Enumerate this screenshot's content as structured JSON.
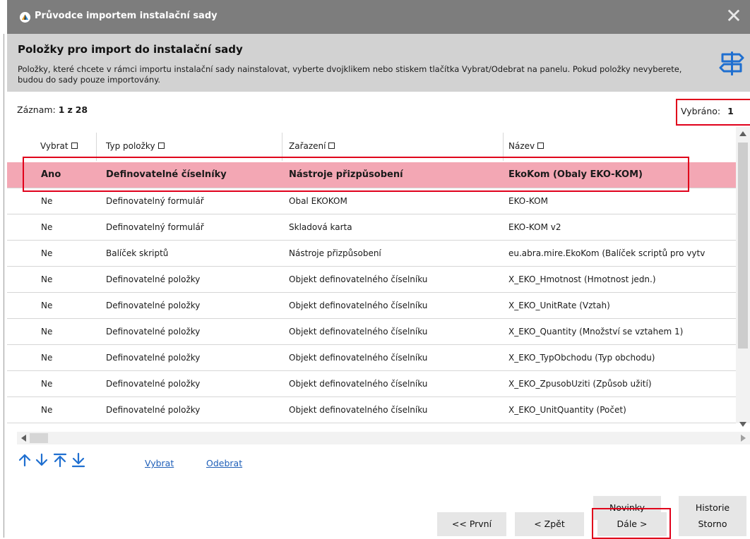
{
  "window": {
    "title": "Průvodce importem instalační sady",
    "close_glyph": "✕"
  },
  "header": {
    "title": "Položky pro import do instalační sady",
    "description": "Položky, které chcete v rámci importu instalační sady nainstalovat, vyberte dvojklikem nebo stiskem tlačítka Vybrat/Odebrat na panelu. Pokud položky nevyberete, budou do sady pouze importovány.",
    "icon": "signpost-icon"
  },
  "record": {
    "label": "Záznam:",
    "current": "1",
    "of": "z",
    "total": "28"
  },
  "selected": {
    "label": "Vybráno:",
    "count": "1"
  },
  "grid": {
    "columns": [
      "Vybrat",
      "Typ položky",
      "Zařazení",
      "Název"
    ],
    "rows": [
      {
        "select": "Ano",
        "type": "Definovatelné číselníky",
        "category": "Nástroje přizpůsobení",
        "name": "EkoKom (Obaly EKO-KOM)"
      },
      {
        "select": "Ne",
        "type": "Definovatelný formulář",
        "category": "Obal EKOKOM",
        "name": "EKO-KOM"
      },
      {
        "select": "Ne",
        "type": "Definovatelný formulář",
        "category": "Skladová karta",
        "name": "EKO-KOM v2"
      },
      {
        "select": "Ne",
        "type": "Balíček skriptů",
        "category": "Nástroje přizpůsobení",
        "name": "eu.abra.mire.EkoKom (Balíček scriptů pro vytv"
      },
      {
        "select": "Ne",
        "type": "Definovatelné položky",
        "category": "Objekt definovatelného číselníku",
        "name": "X_EKO_Hmotnost (Hmotnost jedn.)"
      },
      {
        "select": "Ne",
        "type": "Definovatelné položky",
        "category": "Objekt definovatelného číselníku",
        "name": "X_EKO_UnitRate (Vztah)"
      },
      {
        "select": "Ne",
        "type": "Definovatelné položky",
        "category": "Objekt definovatelného číselníku",
        "name": "X_EKO_Quantity (Množství se vztahem 1)"
      },
      {
        "select": "Ne",
        "type": "Definovatelné položky",
        "category": "Objekt definovatelného číselníku",
        "name": "X_EKO_TypObchodu (Typ obchodu)"
      },
      {
        "select": "Ne",
        "type": "Definovatelné položky",
        "category": "Objekt definovatelného číselníku",
        "name": "X_EKO_ZpusobUziti (Způsob užití)"
      },
      {
        "select": "Ne",
        "type": "Definovatelné položky",
        "category": "Objekt definovatelného číselníku",
        "name": "X_EKO_UnitQuantity (Počet)"
      }
    ]
  },
  "toolbar": {
    "select_link": "Vybrat",
    "remove_link": "Odebrat"
  },
  "buttons": {
    "news": "Novinky",
    "history": "Historie",
    "first": "<< První",
    "back": "< Zpět",
    "next": "Dále >",
    "cancel": "Storno"
  },
  "colors": {
    "titlebar": "#7d7d7d",
    "header": "#d2d2d2",
    "selected_row": "#f3a7b4",
    "highlight": "#e0001b",
    "link": "#1f5fb8",
    "arrow_icons": "#1f6fd0"
  }
}
